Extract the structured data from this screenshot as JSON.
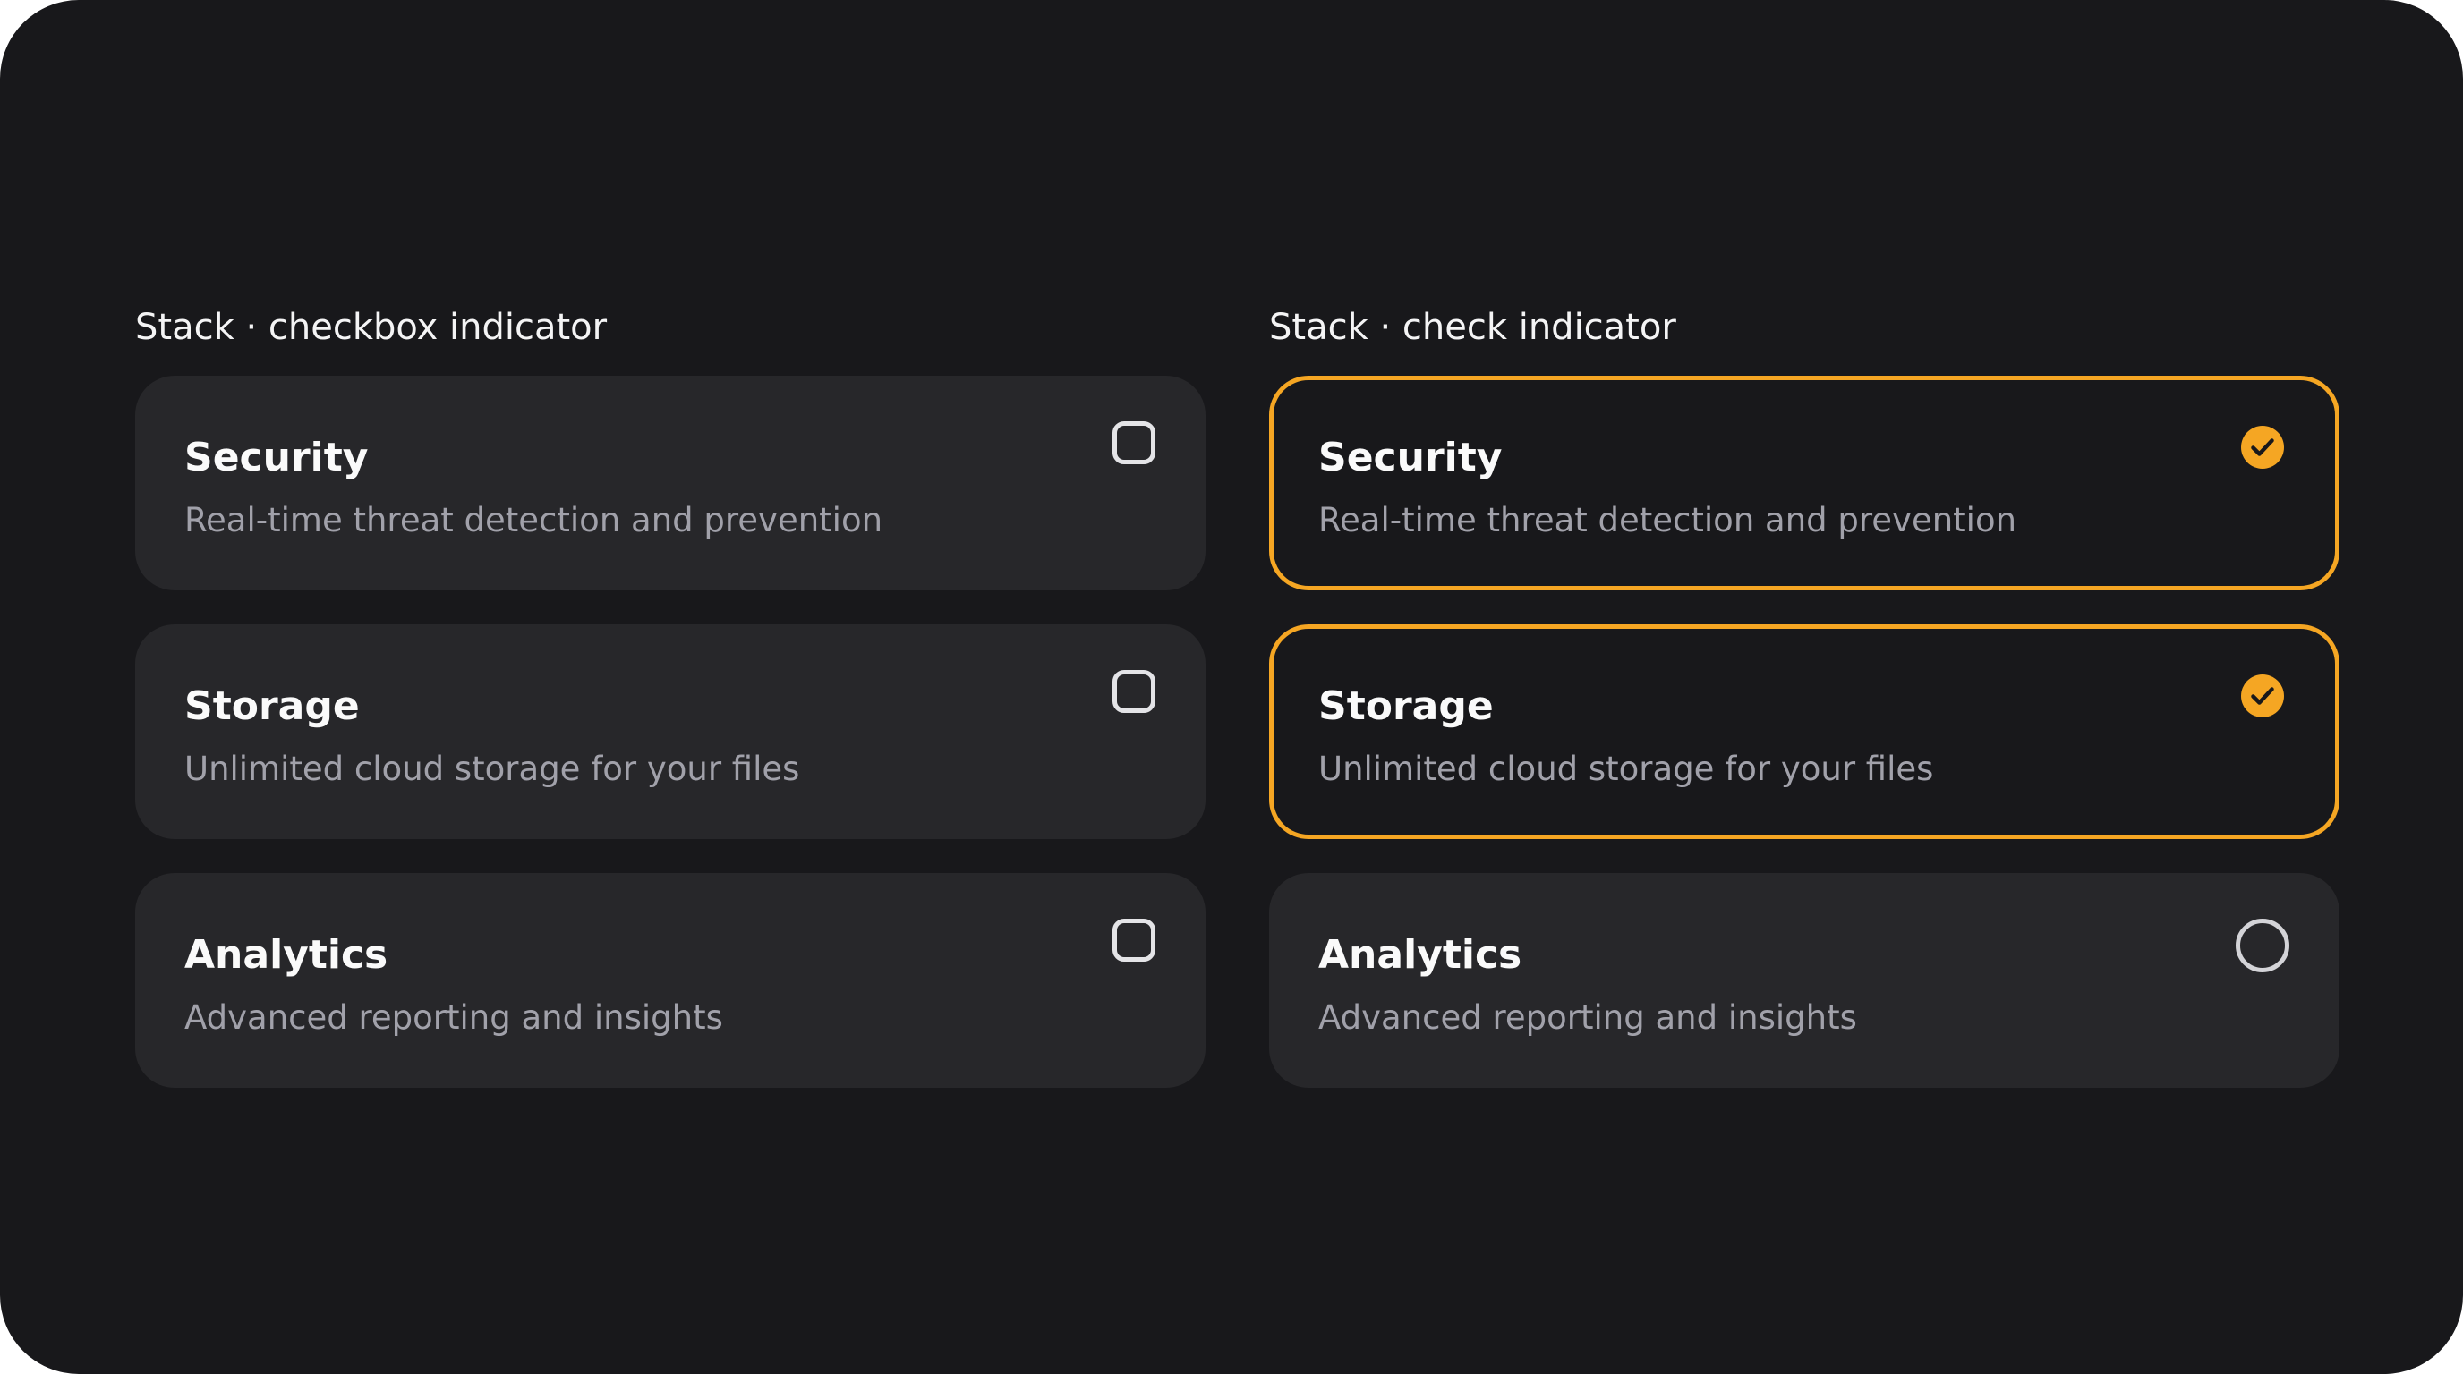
{
  "colors": {
    "background": "#18181b",
    "card_background": "#27272a",
    "accent": "#f5a623",
    "title_text": "#fafafa",
    "description_text": "#a1a1aa"
  },
  "columns": [
    {
      "heading": "Stack · checkbox indicator",
      "indicator_style": "checkbox",
      "options": [
        {
          "title": "Security",
          "description": "Real-time threat detection and prevention",
          "checked": false,
          "icon": "checkbox-empty-icon"
        },
        {
          "title": "Storage",
          "description": "Unlimited cloud storage for your files",
          "checked": false,
          "icon": "checkbox-empty-icon"
        },
        {
          "title": "Analytics",
          "description": "Advanced reporting and insights",
          "checked": false,
          "icon": "checkbox-empty-icon"
        }
      ]
    },
    {
      "heading": "Stack · check indicator",
      "indicator_style": "check",
      "options": [
        {
          "title": "Security",
          "description": "Real-time threat detection and prevention",
          "checked": true,
          "icon": "check-circle-filled-icon"
        },
        {
          "title": "Storage",
          "description": "Unlimited cloud storage for your files",
          "checked": true,
          "icon": "check-circle-filled-icon"
        },
        {
          "title": "Analytics",
          "description": "Advanced reporting and insights",
          "checked": false,
          "icon": "circle-empty-icon"
        }
      ]
    }
  ]
}
